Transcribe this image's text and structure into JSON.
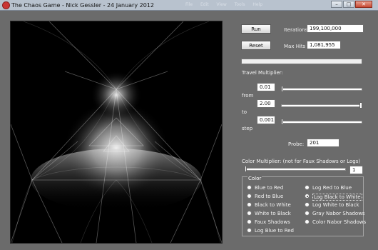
{
  "window": {
    "title": "The Chaos Game - Nick Gessler - 24 January 2012",
    "minimize_glyph": "–",
    "maximize_glyph": "□",
    "close_glyph": "✕"
  },
  "background_menu": [
    "File",
    "Edit",
    "View",
    "Tools",
    "Help"
  ],
  "controls": {
    "run_label": "Run",
    "reset_label": "Reset",
    "iterations_label": "Iterations",
    "iterations_value": "199,100,000",
    "maxhits_label": "Max Hits",
    "maxhits_value": "1,081,955",
    "travel_multiplier_label": "Travel Multiplier:",
    "from_label": "from",
    "from_value": "0.01",
    "to_label": "to",
    "to_value": "2.00",
    "step_label": "step",
    "step_value": "0.001",
    "probe_label": "Probe:",
    "probe_value": "201",
    "color_multiplier_label": "Color Multiplier:  (not for Faux Shadows or Logs)",
    "color_multiplier_value": "1"
  },
  "sliders": {
    "from_position": 0.0,
    "to_position": 1.0,
    "step_position": 0.0,
    "color_multiplier_position": 0.0
  },
  "color_group": {
    "title": "Color",
    "options_left": [
      "Blue to Red",
      "Red to Blue",
      "Black to White",
      "White to Black",
      "Faux Shadows",
      "Log Blue to Red"
    ],
    "options_right": [
      "Log Red to Blue",
      "Log Black to White",
      "Log White to Black",
      "Gray Nabor Shadows",
      "Color Nabor Shadows"
    ],
    "selected": "Log Black to White"
  },
  "colors": {
    "panel_bg": "#6b6b6b",
    "titlebar_bg": "#b8c2ce",
    "fractal_bg": "#000000",
    "fractal_glow": "#ffffff"
  },
  "icons": {
    "app": "red-circle-icon"
  }
}
